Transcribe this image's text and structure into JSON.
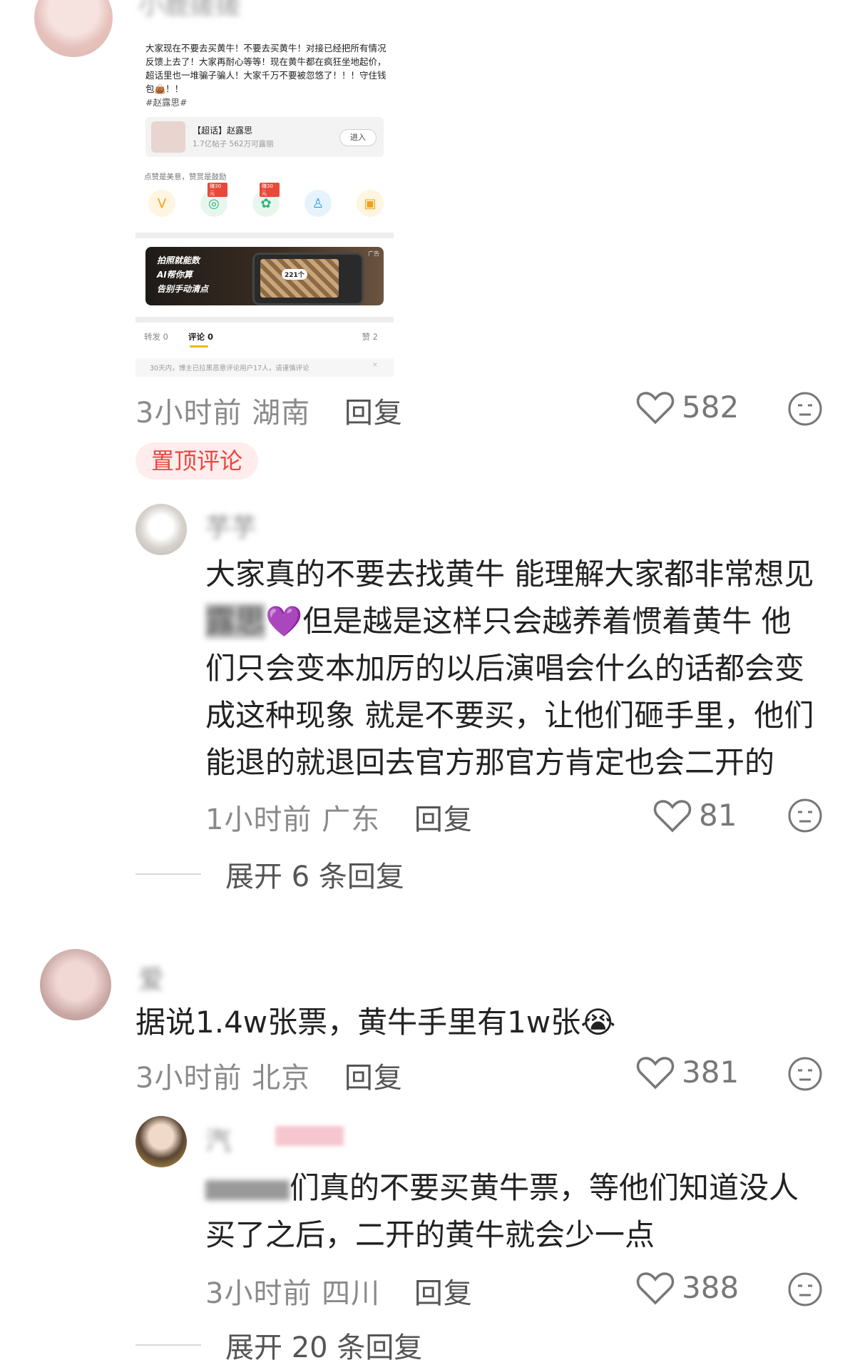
{
  "top_comment": {
    "username": "小鹿搓搓",
    "embedded_screenshot": {
      "post_text": "大家现在不要去买黄牛！不要去买黄牛！对接已经把所有情况反馈上去了！大家再耐心等等！现在黄牛都在疯狂坐地起价，超话里也一堆骗子骗人！大家千万不要被忽悠了！！！守住钱包👜！！",
      "hashtag": "#赵露思#",
      "supertopic_title": "【超话】赵露思",
      "supertopic_stats": "1.7亿帖子 562万可露丽",
      "enter_label": "进入",
      "reward_label": "点赞是美意，赞赏是鼓励",
      "reward_badge_1": "赚30元",
      "reward_badge_2": "赚30元",
      "ad_line_1": "拍照就能数",
      "ad_line_2": "AI帮你算",
      "ad_line_3": "告别手动清点",
      "ad_count": "221个",
      "ad_tag": "广告",
      "tab_repost": "转发 0",
      "tab_comment": "评论 0",
      "tab_like": "赞 2",
      "notice": "30天内，博主已拉黑恶意评论用户17人，请谨慎评论",
      "notice_close": "×"
    },
    "time": "3小时前",
    "location": "湖南",
    "reply_label": "回复",
    "likes": "582",
    "pinned_label": "置顶评论"
  },
  "reply_1": {
    "username": "芋芋",
    "text_before_emoji": "大家真的不要去找黄牛 能理解大家都非常想见",
    "redacted_name": "露思",
    "emoji": "💜",
    "text_after_emoji": "但是越是这样只会越养着惯着黄牛 他们只会变本加厉的以后演唱会什么的话都会变成这种现象 就是不要买，让他们砸手里，他们能退的就退回去官方那官方肯定也会二开的",
    "time": "1小时前",
    "location": "广东",
    "reply_label": "回复",
    "likes": "81",
    "expand_label": "展开 6 条回复"
  },
  "comment_2": {
    "username": "爱",
    "text": "据说1.4w张票，黄牛手里有1w张",
    "emoji": "😭",
    "time": "3小时前",
    "location": "北京",
    "reply_label": "回复",
    "likes": "381"
  },
  "reply_2": {
    "username": "汽",
    "text": "们真的不要买黄牛票，等他们知道没人买了之后，二开的黄牛就会少一点",
    "time": "3小时前",
    "location": "四川",
    "reply_label": "回复",
    "likes": "388",
    "expand_label": "展开 20 条回复"
  },
  "icons": {
    "heart": "heart-outline-icon",
    "react": "emoji-react-icon"
  },
  "colors": {
    "pin_bg": "#ffecec",
    "pin_text": "#e8483f",
    "tab_underline": "#f3b31a"
  }
}
